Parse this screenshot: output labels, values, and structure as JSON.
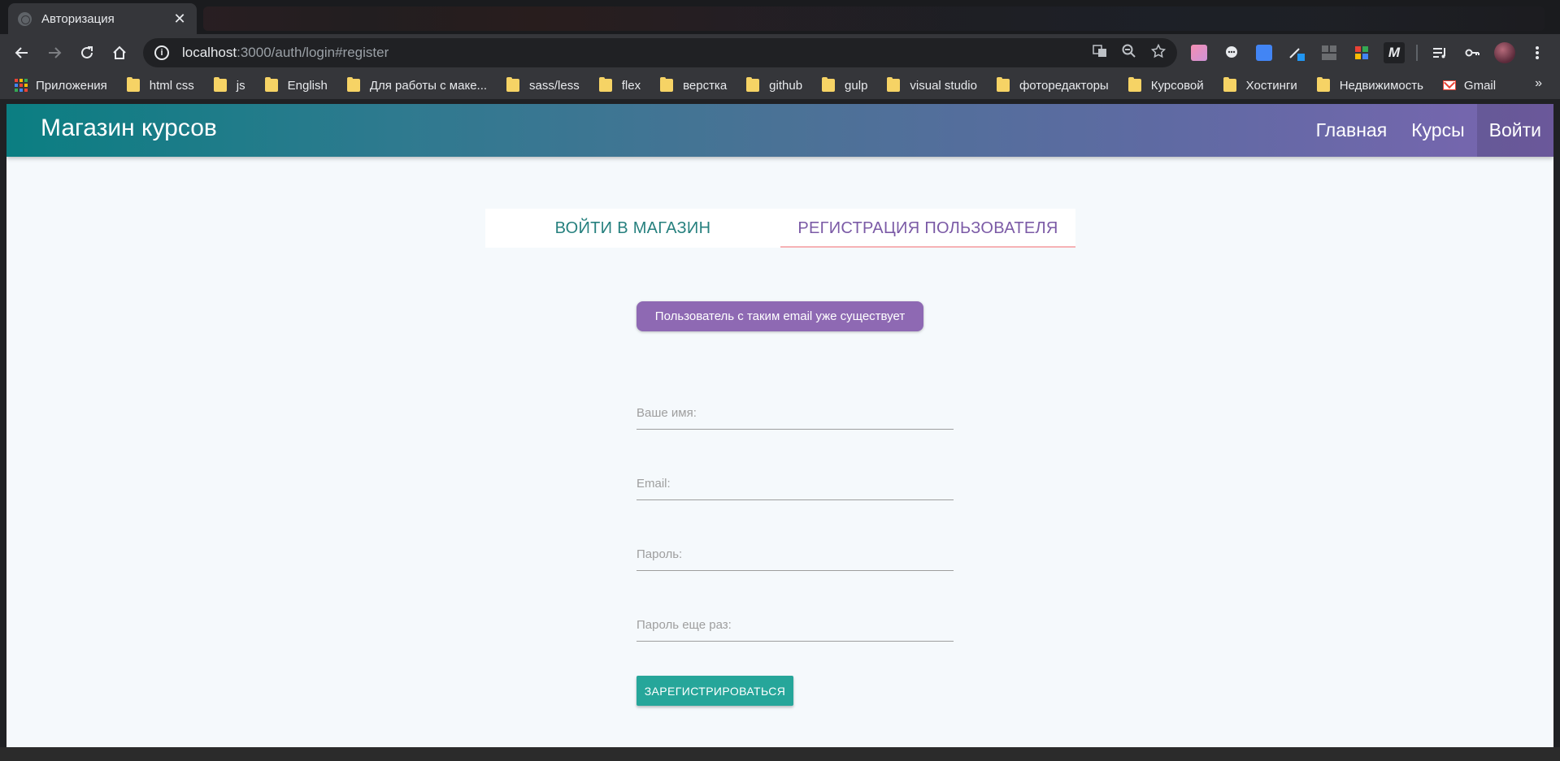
{
  "browser": {
    "tab_title": "Авторизация",
    "tab_close": "✕",
    "url_host": "localhost",
    "url_rest": ":3000/auth/login#register",
    "bookmarks": [
      {
        "label": "Приложения",
        "icon": "apps-grid-icon"
      },
      {
        "label": "html css",
        "icon": "folder-icon"
      },
      {
        "label": "js",
        "icon": "folder-icon"
      },
      {
        "label": "English",
        "icon": "folder-icon"
      },
      {
        "label": "Для работы с маке...",
        "icon": "folder-icon"
      },
      {
        "label": "sass/less",
        "icon": "folder-icon"
      },
      {
        "label": "flex",
        "icon": "folder-icon"
      },
      {
        "label": "верстка",
        "icon": "folder-icon"
      },
      {
        "label": "github",
        "icon": "folder-icon"
      },
      {
        "label": "gulp",
        "icon": "folder-icon"
      },
      {
        "label": "visual studio",
        "icon": "folder-icon"
      },
      {
        "label": "фоторедакторы",
        "icon": "folder-icon"
      },
      {
        "label": "Курсовой",
        "icon": "folder-icon"
      },
      {
        "label": "Хостинги",
        "icon": "folder-icon"
      },
      {
        "label": "Недвижимость",
        "icon": "folder-icon"
      },
      {
        "label": "Gmail",
        "icon": "gmail-icon"
      }
    ],
    "bookmarks_more": "»"
  },
  "navbar": {
    "brand": "Магазин курсов",
    "links": [
      {
        "label": "Главная",
        "active": false
      },
      {
        "label": "Курсы",
        "active": false
      },
      {
        "label": "Войти",
        "active": true
      }
    ]
  },
  "auth_tabs": {
    "login": "Войти в магазин",
    "register": "Регистрация пользователя"
  },
  "error_message": "Пользователь с таким email уже существует",
  "form": {
    "name_placeholder": "Ваше имя:",
    "email_placeholder": "Email:",
    "password_placeholder": "Пароль:",
    "confirm_placeholder": "Пароль еще раз:",
    "submit_label": "Зарегистрироваться"
  },
  "colors": {
    "navbar_start": "#0b7e82",
    "navbar_end": "#7a65b0",
    "error_badge": "#8e69b3",
    "submit_button": "#26a69a",
    "tab_underline": "#f6b2b5"
  }
}
